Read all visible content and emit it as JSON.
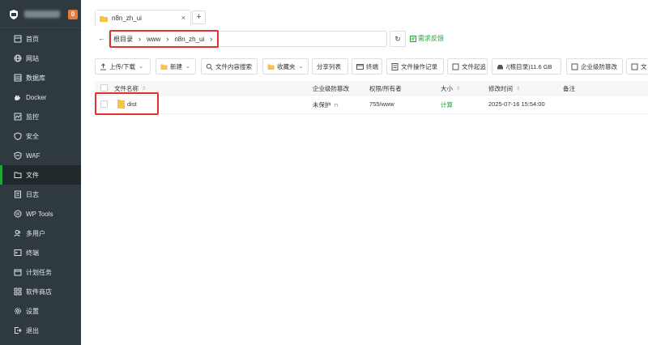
{
  "sidebar": {
    "badge": "0",
    "items": [
      {
        "label": "首页",
        "icon": "home-icon"
      },
      {
        "label": "网站",
        "icon": "globe-icon"
      },
      {
        "label": "数据库",
        "icon": "database-icon"
      },
      {
        "label": "Docker",
        "icon": "docker-icon"
      },
      {
        "label": "监控",
        "icon": "monitor-icon"
      },
      {
        "label": "安全",
        "icon": "shield-icon"
      },
      {
        "label": "WAF",
        "icon": "waf-shield-icon"
      },
      {
        "label": "文件",
        "icon": "folder-icon"
      },
      {
        "label": "日志",
        "icon": "log-icon"
      },
      {
        "label": "WP Tools",
        "icon": "wordpress-icon"
      },
      {
        "label": "多用户",
        "icon": "users-icon"
      },
      {
        "label": "终端",
        "icon": "terminal-icon"
      },
      {
        "label": "计划任务",
        "icon": "calendar-icon"
      },
      {
        "label": "软件商店",
        "icon": "grid-icon"
      },
      {
        "label": "设置",
        "icon": "gear-icon"
      },
      {
        "label": "退出",
        "icon": "logout-icon"
      }
    ],
    "active_index": 7
  },
  "tabs": {
    "title": "n8n_zh_ui",
    "close": "×",
    "add": "+"
  },
  "address": {
    "back": "←",
    "crumbs": [
      "根目录",
      "www",
      "n8n_zh_ui"
    ],
    "refresh": "↻",
    "feedback": "需求反馈"
  },
  "toolbar": {
    "upload": "上传/下载",
    "new": "新建",
    "search_content": "文件内容搜索",
    "favorites": "收藏夹",
    "share_list": "分享列表",
    "terminal": "终端",
    "op_log": "文件操作记录",
    "sync": "文件起追",
    "disk": "/(根目录)11.6 GB",
    "enterprise": "企业级防篡改",
    "more": "文"
  },
  "table": {
    "headers": {
      "name": "文件名称",
      "tamper": "企业级防篡改",
      "perm": "权限/所有者",
      "size": "大小",
      "mtime": "修改时间",
      "note": "备注"
    },
    "rows": [
      {
        "name": "dist",
        "tamper": "未保护",
        "perm": "755/www",
        "size": "计算",
        "mtime": "2025-07-16 15:54:00",
        "note": ""
      }
    ]
  },
  "colors": {
    "accent": "#20a53a",
    "sidebar_bg": "#2f3a40",
    "highlight": "#e0312b"
  }
}
